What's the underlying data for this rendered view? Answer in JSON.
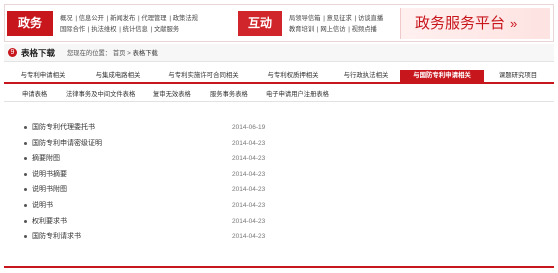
{
  "banner": {
    "gov_label": "政务",
    "gov_links_row1": [
      "概况",
      "信息公开",
      "新闻发布",
      "代理管理",
      "政策法规"
    ],
    "gov_links_row2": [
      "国际合作",
      "执法维权",
      "统计信息",
      "文献服务"
    ],
    "interact_label": "互动",
    "interact_links_row1": [
      "局领导信箱",
      "意见征求",
      "访谈直播"
    ],
    "interact_links_row2": [
      "教育培训",
      "网上信访",
      "视频点播"
    ],
    "platform_title": "政务服务平台",
    "platform_arrow": "»"
  },
  "breadcrumb": {
    "icon": "9",
    "title": "表格下载",
    "prefix": "您现在的位置：",
    "home": "首页",
    "sep": ">",
    "current": "表格下载"
  },
  "tabs": [
    {
      "label": "与专利申请相关",
      "active": false
    },
    {
      "label": "与集成电路相关",
      "active": false
    },
    {
      "label": "与专利实施许可合同相关",
      "active": false
    },
    {
      "label": "与专利权质押相关",
      "active": false
    },
    {
      "label": "与行政执法相关",
      "active": false
    },
    {
      "label": "与国防专利申请相关",
      "active": true
    },
    {
      "label": "课题研究项目",
      "active": false
    }
  ],
  "subtabs": [
    "申请表格",
    "法律事务及中间文件表格",
    "复审无效表格",
    "服务事务表格",
    "电子申请用户注册表格"
  ],
  "items": [
    {
      "title": "国防专利代理委托书",
      "date": "2014-06-19"
    },
    {
      "title": "国防专利申请密级证明",
      "date": "2014-04-23"
    },
    {
      "title": "摘要附图",
      "date": "2014-04-23"
    },
    {
      "title": "说明书摘要",
      "date": "2014-04-23"
    },
    {
      "title": "说明书附图",
      "date": "2014-04-23"
    },
    {
      "title": "说明书",
      "date": "2014-04-23"
    },
    {
      "title": "权利要求书",
      "date": "2014-04-23"
    },
    {
      "title": "国防专利请求书",
      "date": "2014-04-23"
    }
  ]
}
